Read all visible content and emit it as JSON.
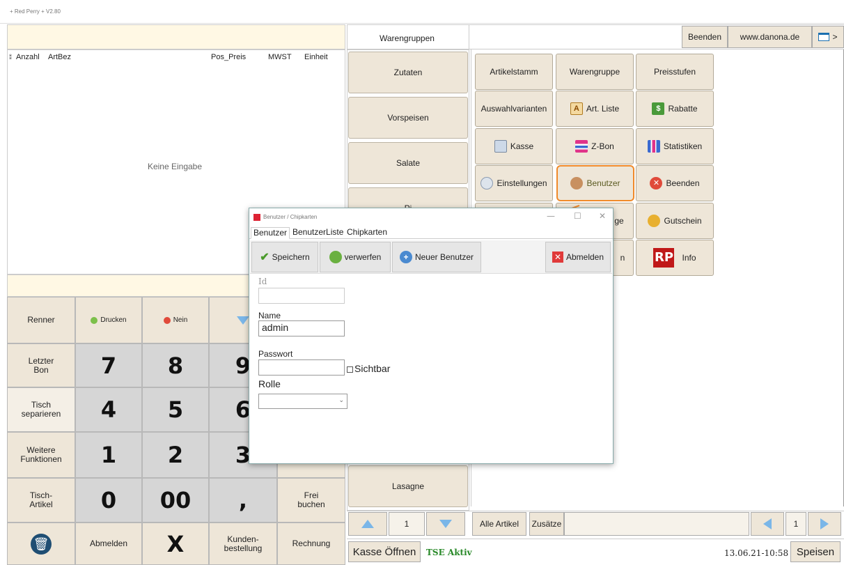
{
  "window": {
    "title": "+ Red Perry + V2.80"
  },
  "order": {
    "columns": [
      "Anzahl",
      "ArtBez",
      "Pos_Preis",
      "MWST",
      "Einheit"
    ],
    "empty_text": "Keine Eingabe"
  },
  "keypad": {
    "renner": "Renner",
    "drucken": "Drucken",
    "nein": "Nein",
    "letzter_bon": "Letzter Bon",
    "tisch_separieren": "Tisch separieren",
    "weitere_funktionen": "Weitere Funktionen",
    "tisch_artikel": "Tisch-Artikel",
    "abmelden": "Abmelden",
    "x": "X",
    "kundenbestellung": "Kunden-bestellung",
    "rechnung": "Rechnung",
    "frei_buchen": "Frei buchen",
    "n7": "7",
    "n8": "8",
    "n9": "9",
    "n4": "4",
    "n5": "5",
    "n6": "6",
    "n1": "1",
    "n2": "2",
    "n3": "3",
    "n0": "0",
    "n00": "00",
    "comma": ","
  },
  "categories": {
    "header": "Warengruppen",
    "items": [
      "Zutaten",
      "Vorspeisen",
      "Salate",
      "Pi",
      "Lasagne"
    ],
    "page": "1"
  },
  "header": {
    "beenden": "Beenden",
    "website": "www.danona.de",
    "more": ">"
  },
  "functions": {
    "artikelstamm": "Artikelstamm",
    "warengruppe": "Warengruppe",
    "preisstufen": "Preisstufen",
    "auswahlvarianten": "Auswahlvarianten",
    "art_liste": "Art. Liste",
    "rabatte": "Rabatte",
    "kasse": "Kasse",
    "z_bon": "Z-Bon",
    "statistiken": "Statistiken",
    "einstellungen": "Einstellungen",
    "benutzer": "Benutzer",
    "beenden": "Beenden",
    "partial_ge": "ge",
    "gutschein": "Gutschein",
    "partial_n": "n",
    "info": "Info"
  },
  "bottom": {
    "alle_artikel": "Alle Artikel",
    "zusaetze": "Zusätze",
    "page": "1",
    "kasse_oeffnen": "Kasse Öffnen",
    "tse": "TSE Aktiv",
    "datetime": "13.06.21-10:58",
    "speisen": "Speisen"
  },
  "dialog": {
    "title": "Benutzer / Chipkarten",
    "tabs": [
      "Benutzer",
      "BenutzerListe",
      "Chipkarten"
    ],
    "speichern": "Speichern",
    "verwerfen": "verwerfen",
    "neuer_benutzer": "Neuer Benutzer",
    "abmelden": "Abmelden",
    "id_label": "Id",
    "id_value": "",
    "name_label": "Name",
    "name_value": "admin",
    "passwort_label": "Passwort",
    "passwort_value": "",
    "sichtbar_label": "Sichtbar",
    "rolle_label": "Rolle",
    "rolle_value": ""
  },
  "colors": {
    "button_bg": "#eee6d8",
    "highlight": "#f08a2a",
    "tse_green": "#2a8a2a"
  }
}
